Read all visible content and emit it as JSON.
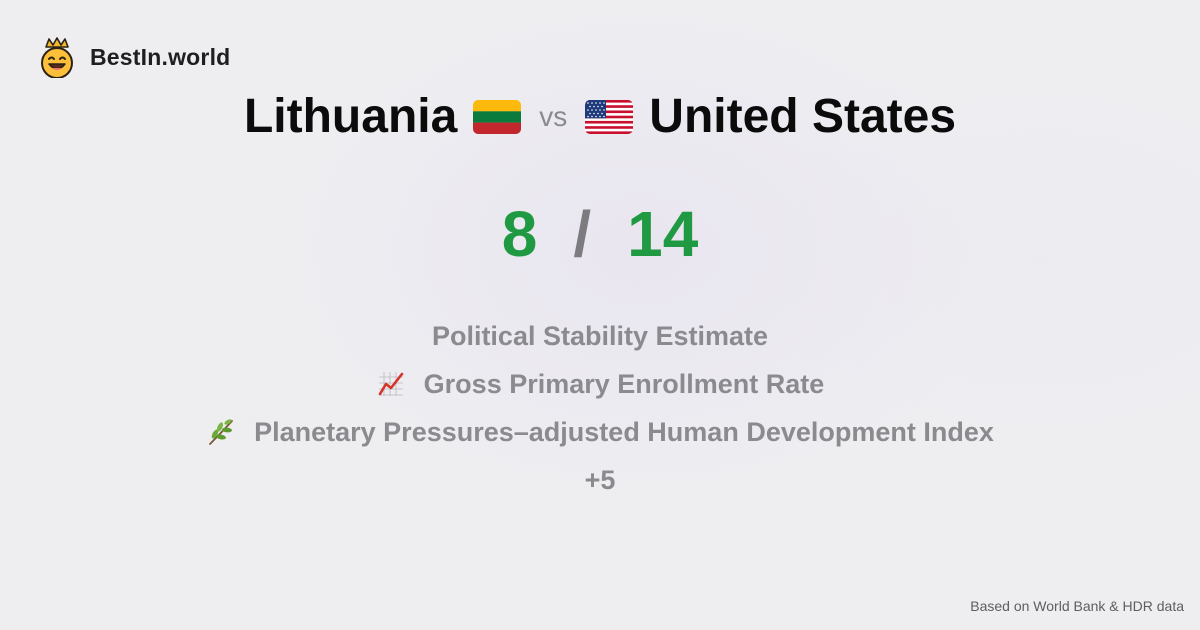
{
  "brand": {
    "name": "BestIn.world",
    "icon": "crown-smiley-icon"
  },
  "comparison": {
    "left_country": "Lithuania",
    "left_flag": "lithuania-flag-icon",
    "vs_label": "vs",
    "right_country": "United States",
    "right_flag": "usa-flag-icon"
  },
  "score": {
    "left": "8",
    "separator": "/",
    "right": "14",
    "color_win": "#1f9a43"
  },
  "metrics": [
    {
      "label": "Political Stability Estimate",
      "icon": ""
    },
    {
      "label": "Gross Primary Enrollment Rate",
      "icon": "chart-increasing-icon"
    },
    {
      "label": "Planetary Pressures–adjusted Human Development Index",
      "icon": "herb-icon"
    }
  ],
  "more_label": "+5",
  "footer": {
    "source": "Based on World Bank & HDR data"
  }
}
